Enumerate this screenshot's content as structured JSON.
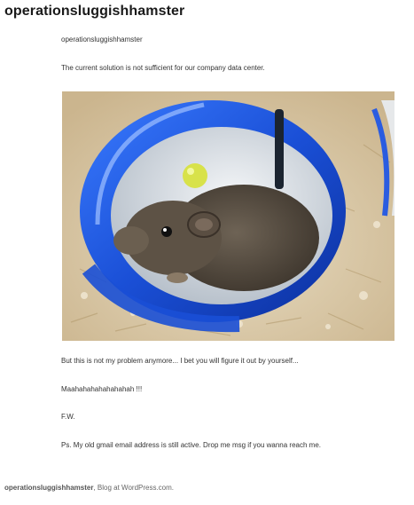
{
  "site": {
    "title": "operationsluggishhamster"
  },
  "post": {
    "title": "operationsluggishhamster",
    "paragraphs": [
      "The current solution is not sufficient for our company data center.",
      "But this is not my problem anymore... I bet you will figure it out by yourself...",
      "Maahahahahahahahah !!!",
      "F.W.",
      "Ps. My old gmail email address is still active. Drop me msg if you wanna reach me."
    ],
    "image": {
      "subject": "rodent in blue exercise wheel",
      "colors": {
        "wheel": "#1a4fd6",
        "bedding": "#d9c6a3",
        "rodent": "#5a5046"
      }
    }
  },
  "footer": {
    "site_link": "operationsluggishhamster",
    "suffix": ", Blog at WordPress.com."
  }
}
